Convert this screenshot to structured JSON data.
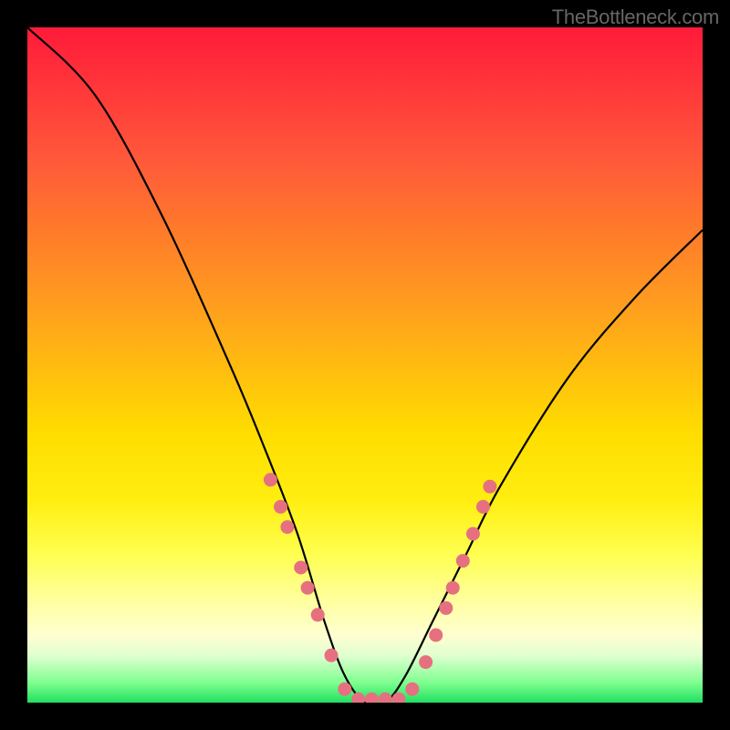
{
  "watermark": "TheBottleneck.com",
  "chart_data": {
    "type": "line",
    "title": "",
    "xlabel": "",
    "ylabel": "",
    "xlim": [
      0,
      100
    ],
    "ylim": [
      0,
      100
    ],
    "background_gradient": {
      "orientation": "vertical",
      "stops": [
        {
          "pos": 0,
          "color": "#ff1a3a",
          "meaning": "worst"
        },
        {
          "pos": 50,
          "color": "#ffdd00",
          "meaning": "mid"
        },
        {
          "pos": 100,
          "color": "#20e060",
          "meaning": "best"
        }
      ]
    },
    "series": [
      {
        "name": "bottleneck-curve",
        "x": [
          0,
          10,
          20,
          30,
          35,
          40,
          44,
          47,
          50,
          53,
          56,
          60,
          65,
          70,
          80,
          90,
          100
        ],
        "y": [
          100,
          90,
          72,
          50,
          38,
          25,
          12,
          4,
          0,
          0,
          4,
          12,
          22,
          32,
          48,
          60,
          70
        ]
      }
    ],
    "markers": {
      "name": "data-points",
      "color": "#e67080",
      "points": [
        {
          "x": 36,
          "y": 33
        },
        {
          "x": 37.5,
          "y": 29
        },
        {
          "x": 38.5,
          "y": 26
        },
        {
          "x": 40.5,
          "y": 20
        },
        {
          "x": 41.5,
          "y": 17
        },
        {
          "x": 43,
          "y": 13
        },
        {
          "x": 45,
          "y": 7
        },
        {
          "x": 47,
          "y": 2
        },
        {
          "x": 49,
          "y": 0.5
        },
        {
          "x": 51,
          "y": 0.5
        },
        {
          "x": 53,
          "y": 0.5
        },
        {
          "x": 55,
          "y": 0.5
        },
        {
          "x": 57,
          "y": 2
        },
        {
          "x": 59,
          "y": 6
        },
        {
          "x": 60.5,
          "y": 10
        },
        {
          "x": 62,
          "y": 14
        },
        {
          "x": 63,
          "y": 17
        },
        {
          "x": 64.5,
          "y": 21
        },
        {
          "x": 66,
          "y": 25
        },
        {
          "x": 67.5,
          "y": 29
        },
        {
          "x": 68.5,
          "y": 32
        }
      ]
    }
  }
}
